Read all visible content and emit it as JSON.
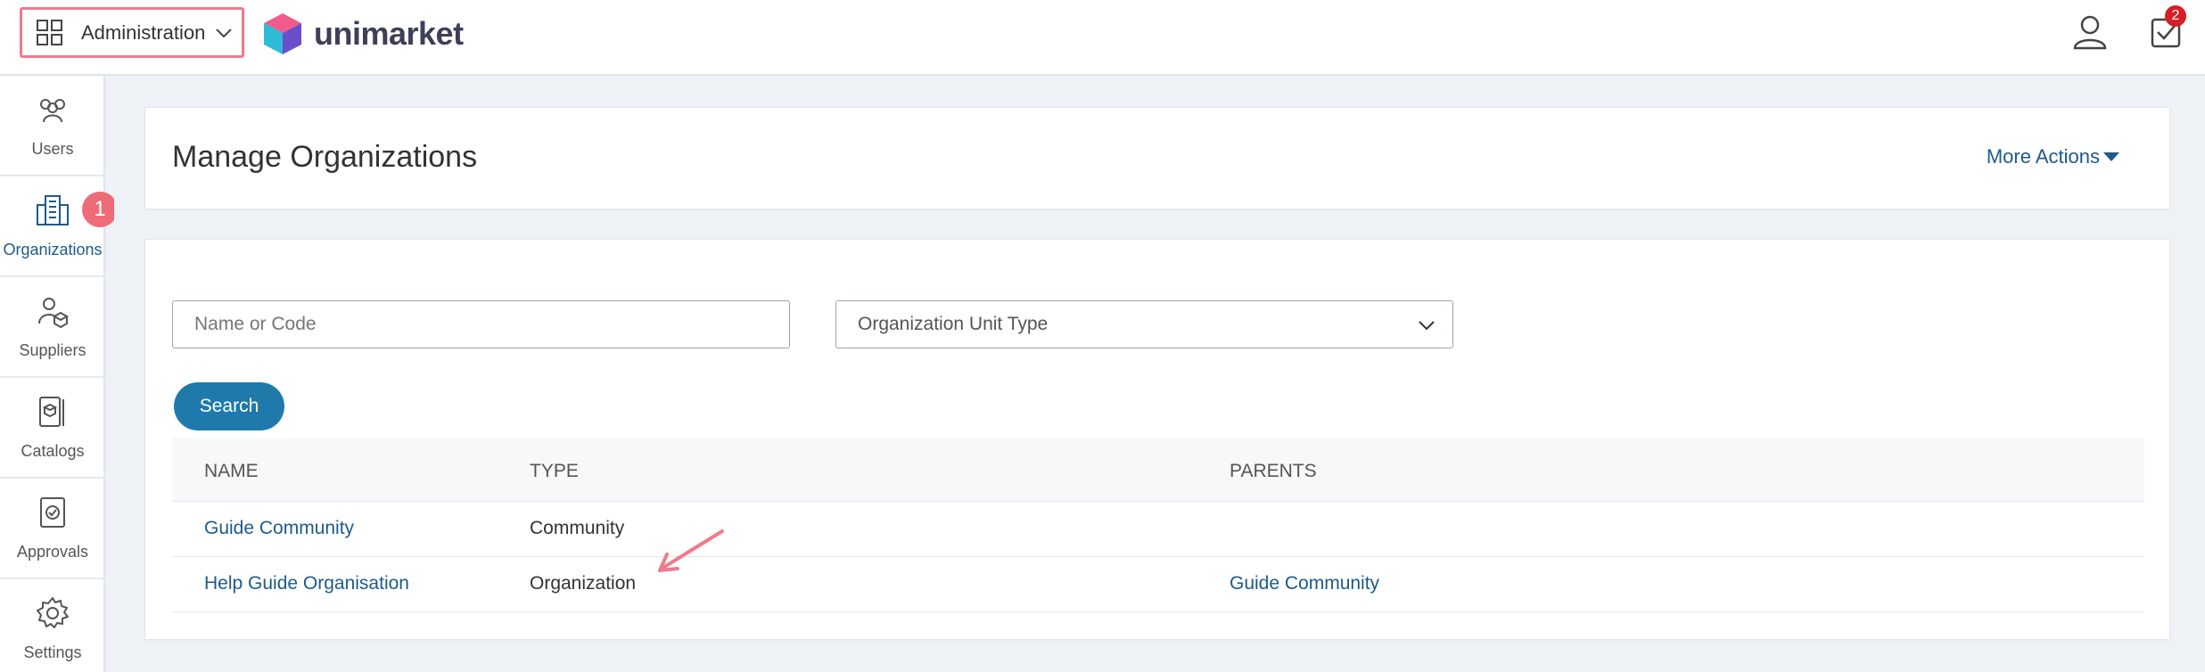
{
  "header": {
    "app_switcher_label": "Administration",
    "logo_text": "unimarket",
    "tasks_count": "2"
  },
  "sidebar": {
    "items": [
      {
        "label": "Users",
        "icon": "users-icon"
      },
      {
        "label": "Organizations",
        "icon": "building-icon",
        "active": true
      },
      {
        "label": "Suppliers",
        "icon": "supplier-icon"
      },
      {
        "label": "Catalogs",
        "icon": "catalog-icon"
      },
      {
        "label": "Approvals",
        "icon": "approval-icon"
      },
      {
        "label": "Settings",
        "icon": "gear-icon"
      }
    ],
    "step_badge": "1"
  },
  "page": {
    "title": "Manage Organizations",
    "more_actions": "More Actions"
  },
  "search": {
    "name_placeholder": "Name or Code",
    "type_select": "Organization Unit Type",
    "button": "Search"
  },
  "table": {
    "headers": [
      "NAME",
      "TYPE",
      "PARENTS"
    ],
    "rows": [
      {
        "name": "Guide Community",
        "type": "Community",
        "parents": ""
      },
      {
        "name": "Help Guide Organisation",
        "type": "Organization",
        "parents": "Guide Community"
      }
    ]
  },
  "colors": {
    "accent": "#1d5a8c",
    "button": "#1f7aab",
    "highlight": "#ee7b8a",
    "badge": "#d51f26"
  }
}
